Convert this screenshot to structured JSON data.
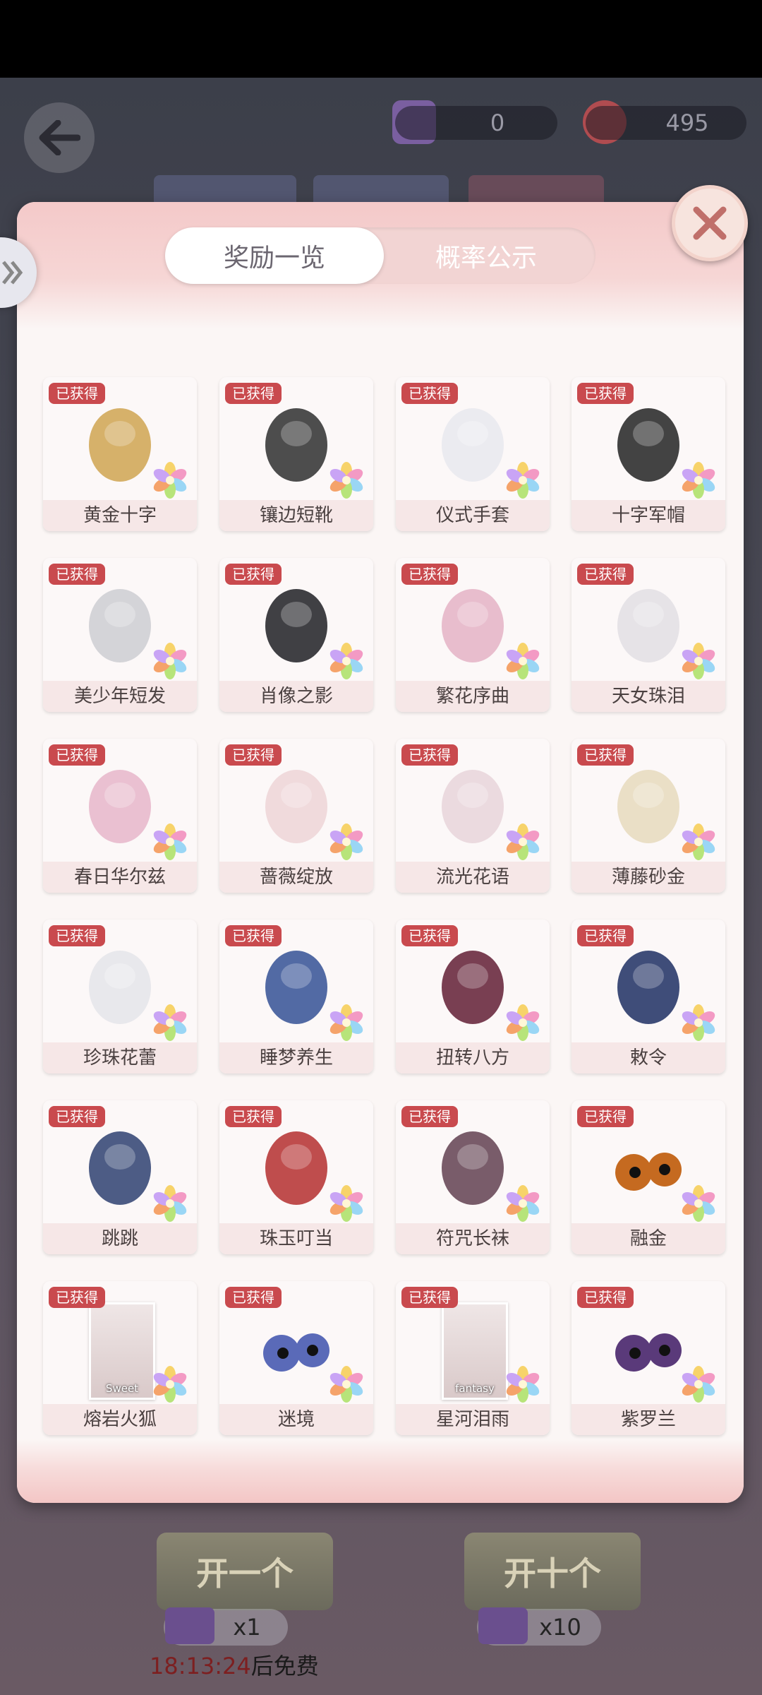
{
  "header": {
    "ticket_count": "0",
    "gem_count": "495"
  },
  "tabs": [
    {
      "label": "奖励一览",
      "active": true
    },
    {
      "label": "概率公示",
      "active": false
    }
  ],
  "badge_text": "已获得",
  "items": [
    {
      "name": "黄金十字",
      "icon": "gold-cross-earrings-icon"
    },
    {
      "name": "镶边短靴",
      "icon": "boots-icon"
    },
    {
      "name": "仪式手套",
      "icon": "gloves-icon"
    },
    {
      "name": "十字军帽",
      "icon": "military-cap-icon"
    },
    {
      "name": "美少年短发",
      "icon": "wig-icon"
    },
    {
      "name": "肖像之影",
      "icon": "coat-icon"
    },
    {
      "name": "繁花序曲",
      "icon": "dress-icon"
    },
    {
      "name": "天女珠泪",
      "icon": "pearl-necklace-icon"
    },
    {
      "name": "春日华尔兹",
      "icon": "shoes-icon"
    },
    {
      "name": "蔷薇绽放",
      "icon": "gloves-icon"
    },
    {
      "name": "流光花语",
      "icon": "fan-icon"
    },
    {
      "name": "薄藤砂金",
      "icon": "hair-icon"
    },
    {
      "name": "珍珠花蕾",
      "icon": "earrings-icon"
    },
    {
      "name": "睡梦养生",
      "icon": "jacket-icon"
    },
    {
      "name": "扭转八方",
      "icon": "braids-icon"
    },
    {
      "name": "敕令",
      "icon": "hat-icon"
    },
    {
      "name": "跳跳",
      "icon": "boots-icon"
    },
    {
      "name": "珠玉叮当",
      "icon": "ornament-icon"
    },
    {
      "name": "符咒长袜",
      "icon": "stockings-icon"
    },
    {
      "name": "融金",
      "icon": "eyes-icon"
    },
    {
      "name": "熔岩火狐",
      "icon": "makeup-portrait-icon",
      "card_text": "Sweet"
    },
    {
      "name": "迷境",
      "icon": "eyes-icon"
    },
    {
      "name": "星河泪雨",
      "icon": "makeup-portrait-icon",
      "card_text": "fantasy"
    },
    {
      "name": "紫罗兰",
      "icon": "eyes-icon"
    }
  ],
  "bottom": {
    "open_one": "开一个",
    "open_ten": "开十个",
    "cost_one": "x1",
    "cost_ten": "x10",
    "timer": "18:13:24",
    "timer_suffix": "后免费"
  },
  "colors": {
    "badge": "#c94a4e",
    "panel": "#fbf6f5",
    "panel_accent": "#f4c9c9"
  }
}
